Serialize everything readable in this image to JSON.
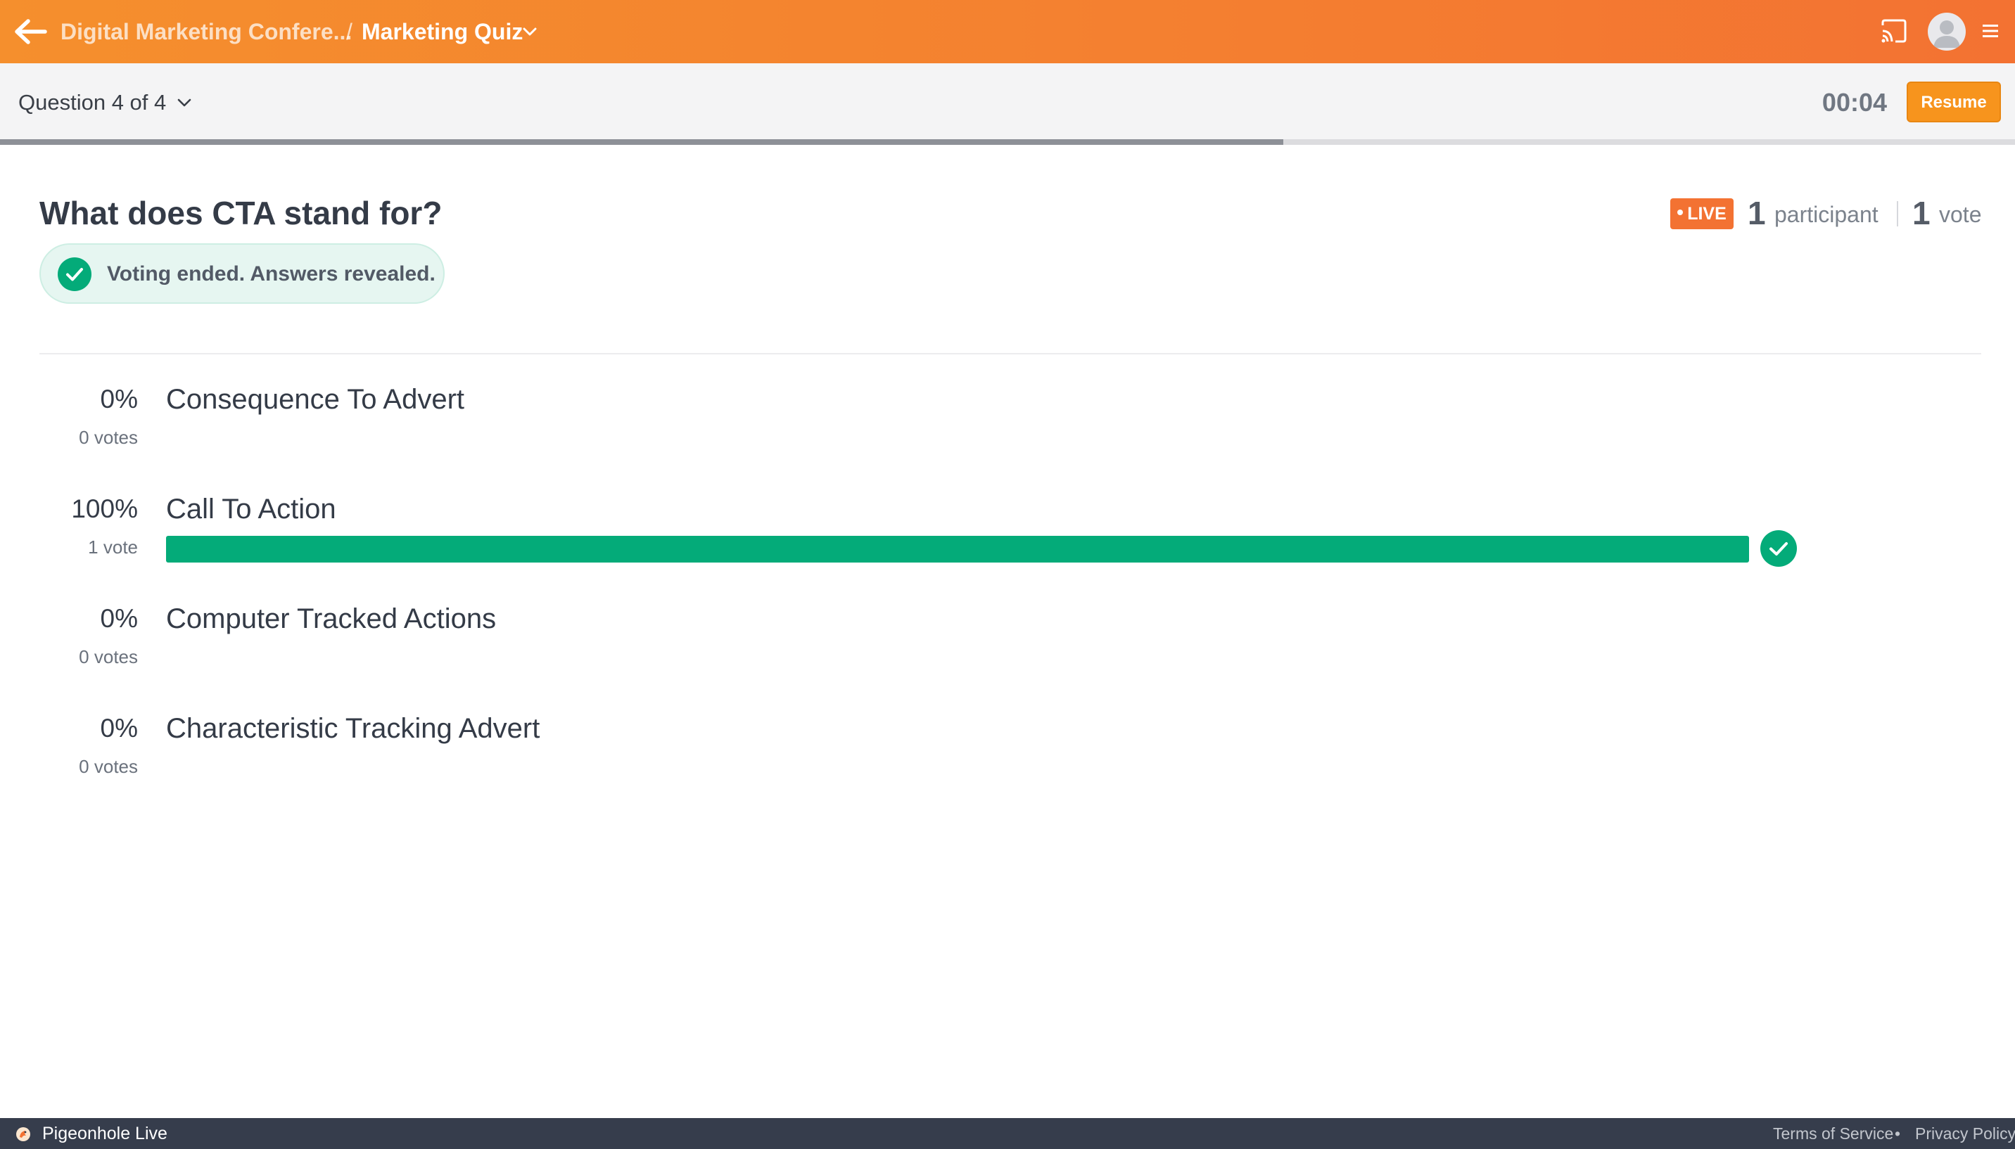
{
  "header": {
    "back_icon": "arrow-left-icon",
    "breadcrumb_event": "Digital Marketing Confere...",
    "breadcrumb_separator": "/",
    "breadcrumb_current": "Marketing Quiz",
    "dropdown_icon": "chevron-down-icon",
    "cast_icon": "cast-icon",
    "avatar_icon": "user-avatar-icon",
    "menu_icon": "hamburger-menu-icon",
    "colors": {
      "gradient_start": "#f58f2d",
      "gradient_end": "#f37232"
    }
  },
  "subheader": {
    "question_selector": "Question 4 of 4",
    "timer": "00:04",
    "resume_label": "Resume",
    "progress_fraction": 0.637
  },
  "question": {
    "title": "What does CTA stand for?",
    "status_text": "Voting ended. Answers revealed.",
    "live_label": "LIVE",
    "participant_count": "1",
    "participant_label": "participant",
    "vote_count": "1",
    "vote_label": "vote"
  },
  "options": [
    {
      "percent": "0%",
      "votes": "0 votes",
      "label": "Consequence To Advert",
      "fraction": 0,
      "correct": false
    },
    {
      "percent": "100%",
      "votes": "1 vote",
      "label": "Call To Action",
      "fraction": 1,
      "correct": true
    },
    {
      "percent": "0%",
      "votes": "0 votes",
      "label": "Computer Tracked Actions",
      "fraction": 0,
      "correct": false
    },
    {
      "percent": "0%",
      "votes": "0 votes",
      "label": "Characteristic Tracking Advert",
      "fraction": 0,
      "correct": false
    }
  ],
  "colors": {
    "accent": "#f7941d",
    "correct": "#04ab79",
    "live": "#f37232",
    "footer": "#363d4c"
  },
  "footer": {
    "brand": "Pigeonhole Live",
    "terms": "Terms of Service",
    "separator": "•",
    "privacy": "Privacy Policy"
  }
}
